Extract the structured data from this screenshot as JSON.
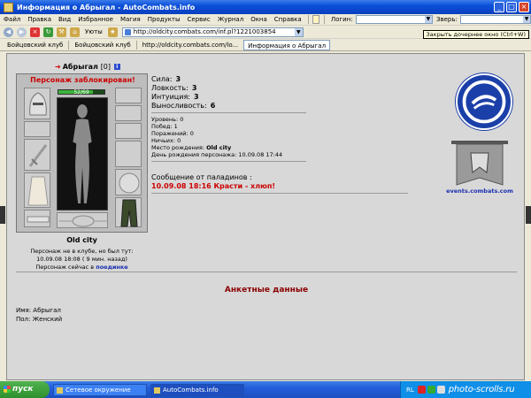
{
  "window": {
    "title": "Информация о Абрыгал - AutoCombats.info"
  },
  "menu": {
    "items": [
      "Файл",
      "Правка",
      "Вид",
      "Избранное",
      "Магия",
      "Продукты",
      "Сервис",
      "Журнал",
      "Окна",
      "Справка"
    ],
    "login_label": "Логин:",
    "zver_label": "Зверь:"
  },
  "toolbar": {
    "uyuty_label": "Уюты",
    "address": "http://oldcity.combats.com/inf.pl?1221003854",
    "tooltip": "Закрыть дочернее окно (Ctrl+W)"
  },
  "tabs": [
    {
      "label": "Бойцовский клуб",
      "active": false
    },
    {
      "label": "Бойцовский клуб",
      "active": false
    },
    {
      "label": "http://oldcity.combats.com/lo...",
      "active": false
    },
    {
      "label": "Информация о Абрыгал",
      "active": true
    }
  ],
  "character": {
    "name": "Абрыгал",
    "level": "[0]",
    "info_icon": "i",
    "blocked": "Персонаж заблокирован!",
    "hp": "52/69",
    "hp_fraction": 0.75,
    "city": "Old city",
    "status_line1": "Персонаж не в клубе, но был тут:",
    "status_line2": "10.09.08 18:08 ( 9 мин. назад)",
    "location_prefix": "Персонаж сейчас в",
    "location_link": "поединке"
  },
  "stats": [
    {
      "label": "Сила:",
      "value": "3"
    },
    {
      "label": "Ловкость:",
      "value": "3"
    },
    {
      "label": "Интуиция:",
      "value": "3"
    },
    {
      "label": "Выносливость:",
      "value": "6"
    }
  ],
  "details": {
    "level": "Уровень: 0",
    "wins": "Побед: 1",
    "losses": "Поражений: 0",
    "draws": "Ничьих: 0",
    "birthplace_label": "Место рождения:",
    "birthplace": "Old city",
    "birthday": "День рождения персонажа: 10.09.08 17:44"
  },
  "paladins": {
    "title": "Сообщение от паладинов :",
    "message": "10.09.08 18:16 Красти - хлюп!"
  },
  "banner_text": "events.combats.com",
  "anketa": {
    "title": "Анкетные данные",
    "name_line": "Имя:  Абрыгал",
    "sex_line": "Пол:  Женский"
  },
  "taskbar": {
    "start": "пуск",
    "items": [
      "Сетевое окружение",
      "AutoCombats.info"
    ],
    "tray_lang": "RL",
    "watermark": "photo-scrolls.ru"
  },
  "colors": {
    "blocked": "#cc0000",
    "paladin_msg": "#cc0000",
    "anketa_title": "#8b0000",
    "link": "#1a2fb0",
    "emblem": "#1b3fa8"
  }
}
